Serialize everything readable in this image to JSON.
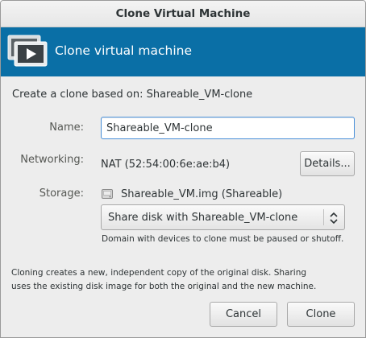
{
  "window": {
    "title": "Clone Virtual Machine"
  },
  "header": {
    "title": "Clone virtual machine",
    "bg_color": "#0a6fa6",
    "icon": "monitor-play-icon"
  },
  "intro": {
    "text": "Create a clone based on: Shareable_VM-clone"
  },
  "fields": {
    "name_label": "Name:",
    "name_value": "Shareable_VM-clone",
    "networking_label": "Networking:",
    "networking_value": "NAT (52:54:00:6e:ae:b4)",
    "details_button": "Details...",
    "storage_label": "Storage:",
    "storage_disk": "Shareable_VM.img (Shareable)",
    "storage_option": "Share disk with Shareable_VM-clone",
    "storage_hint": "Domain with devices to clone must be paused or shutoff."
  },
  "note": {
    "line1": "Cloning creates a new, independent copy of the original disk. Sharing",
    "line2": "uses the existing disk image for both the original and the new machine."
  },
  "buttons": {
    "cancel": "Cancel",
    "clone": "Clone"
  }
}
